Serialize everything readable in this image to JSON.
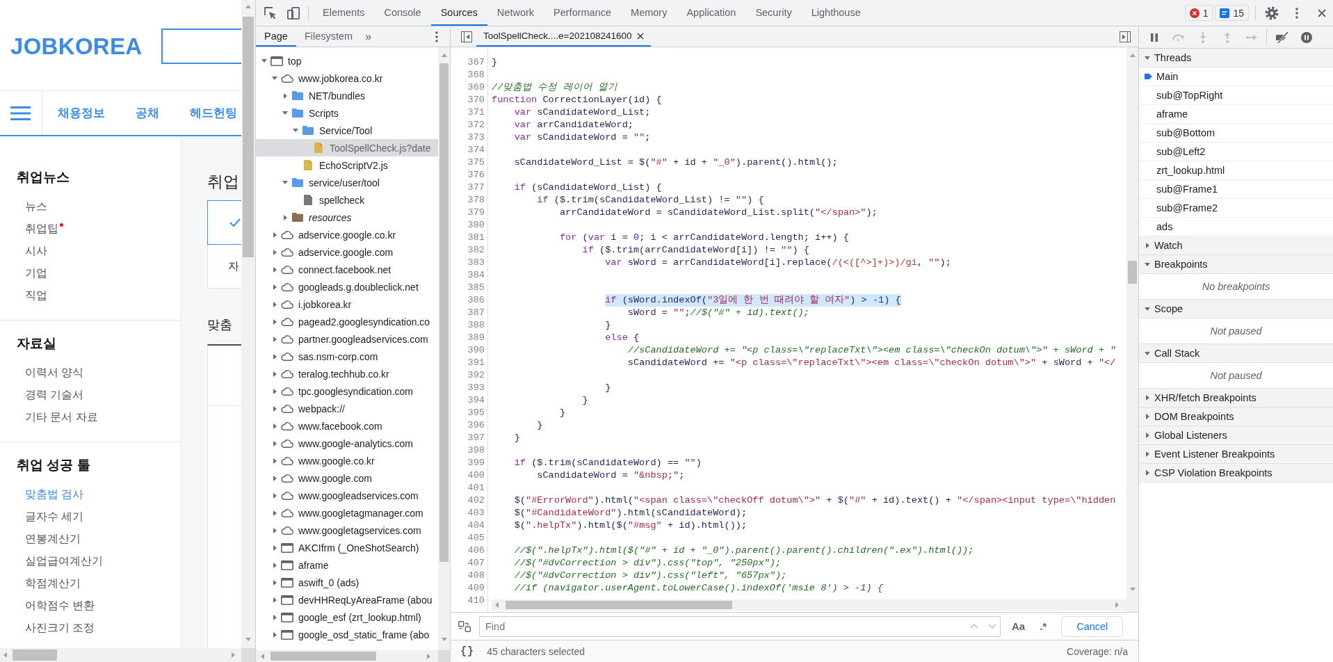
{
  "website": {
    "logo": "JOBKOREA",
    "nav_items": [
      "채용정보",
      "공채",
      "헤드헌팅"
    ],
    "sidebar": [
      {
        "title": "취업뉴스",
        "items": [
          {
            "label": "뉴스",
            "selected": false,
            "new": false
          },
          {
            "label": "취업팁",
            "selected": false,
            "new": true
          },
          {
            "label": "시사",
            "selected": false,
            "new": false
          },
          {
            "label": "기업",
            "selected": false,
            "new": false
          },
          {
            "label": "직업",
            "selected": false,
            "new": false
          }
        ]
      },
      {
        "title": "자료실",
        "items": [
          {
            "label": "이력서 양식",
            "selected": false,
            "new": false
          },
          {
            "label": "경력 기술서",
            "selected": false,
            "new": false
          },
          {
            "label": "기타 문서 자료",
            "selected": false,
            "new": false
          }
        ]
      },
      {
        "title": "취업 성공 툴",
        "items": [
          {
            "label": "맞춤법 검사",
            "selected": true,
            "new": false
          },
          {
            "label": "글자수 세기",
            "selected": false,
            "new": false
          },
          {
            "label": "연봉계산기",
            "selected": false,
            "new": false
          },
          {
            "label": "실업급여계산기",
            "selected": false,
            "new": false
          },
          {
            "label": "학점계산기",
            "selected": false,
            "new": false
          },
          {
            "label": "어학점수 변환",
            "selected": false,
            "new": false
          },
          {
            "label": "사진크기 조정",
            "selected": false,
            "new": false
          }
        ]
      }
    ],
    "content": {
      "heading": "취업",
      "step_label": "자",
      "section_heading": "맞춤"
    }
  },
  "devtools": {
    "tabs": [
      {
        "label": "Elements",
        "selected": false
      },
      {
        "label": "Console",
        "selected": false
      },
      {
        "label": "Sources",
        "selected": true
      },
      {
        "label": "Network",
        "selected": false
      },
      {
        "label": "Performance",
        "selected": false
      },
      {
        "label": "Memory",
        "selected": false
      },
      {
        "label": "Application",
        "selected": false
      },
      {
        "label": "Security",
        "selected": false
      },
      {
        "label": "Lighthouse",
        "selected": false
      }
    ],
    "error_count": "1",
    "message_count": "15",
    "navigator": {
      "tabs": [
        {
          "label": "Page",
          "selected": true
        },
        {
          "label": "Filesystem",
          "selected": false
        }
      ],
      "more_tabs": "»",
      "tree": [
        {
          "label": "top",
          "kind": "frame",
          "expanded": true,
          "selected": false,
          "children": [
            {
              "label": "www.jobkorea.co.kr",
              "kind": "domain",
              "expanded": true,
              "selected": false,
              "children": [
                {
                  "label": "NET/bundles",
                  "kind": "folder",
                  "expanded": false,
                  "selected": false
                },
                {
                  "label": "Scripts",
                  "kind": "folder",
                  "expanded": true,
                  "selected": false,
                  "children": [
                    {
                      "label": "Service/Tool",
                      "kind": "folder",
                      "expanded": true,
                      "selected": false,
                      "children": [
                        {
                          "label": "ToolSpellCheck.js?date",
                          "kind": "script",
                          "selected": true
                        }
                      ]
                    },
                    {
                      "label": "EchoScriptV2.js",
                      "kind": "script",
                      "selected": false
                    }
                  ]
                },
                {
                  "label": "service/user/tool",
                  "kind": "folder",
                  "expanded": true,
                  "selected": false,
                  "children": [
                    {
                      "label": "spellcheck",
                      "kind": "document",
                      "selected": false
                    }
                  ]
                },
                {
                  "label": "resources",
                  "kind": "resources",
                  "expanded": false,
                  "selected": false
                }
              ]
            },
            {
              "label": "adservice.google.co.kr",
              "kind": "domain",
              "expanded": false,
              "selected": false
            },
            {
              "label": "adservice.google.com",
              "kind": "domain",
              "expanded": false,
              "selected": false
            },
            {
              "label": "connect.facebook.net",
              "kind": "domain",
              "expanded": false,
              "selected": false
            },
            {
              "label": "googleads.g.doubleclick.net",
              "kind": "domain",
              "expanded": false,
              "selected": false
            },
            {
              "label": "i.jobkorea.kr",
              "kind": "domain",
              "expanded": false,
              "selected": false
            },
            {
              "label": "pagead2.googlesyndication.co",
              "kind": "domain",
              "expanded": false,
              "selected": false
            },
            {
              "label": "partner.googleadservices.com",
              "kind": "domain",
              "expanded": false,
              "selected": false
            },
            {
              "label": "sas.nsm-corp.com",
              "kind": "domain",
              "expanded": false,
              "selected": false
            },
            {
              "label": "teralog.techhub.co.kr",
              "kind": "domain",
              "expanded": false,
              "selected": false
            },
            {
              "label": "tpc.googlesyndication.com",
              "kind": "domain",
              "expanded": false,
              "selected": false
            },
            {
              "label": "webpack://",
              "kind": "domain",
              "expanded": false,
              "selected": false
            },
            {
              "label": "www.facebook.com",
              "kind": "domain",
              "expanded": false,
              "selected": false
            },
            {
              "label": "www.google-analytics.com",
              "kind": "domain",
              "expanded": false,
              "selected": false
            },
            {
              "label": "www.google.co.kr",
              "kind": "domain",
              "expanded": false,
              "selected": false
            },
            {
              "label": "www.google.com",
              "kind": "domain",
              "expanded": false,
              "selected": false
            },
            {
              "label": "www.googleadservices.com",
              "kind": "domain",
              "expanded": false,
              "selected": false
            },
            {
              "label": "www.googletagmanager.com",
              "kind": "domain",
              "expanded": false,
              "selected": false
            },
            {
              "label": "www.googletagservices.com",
              "kind": "domain",
              "expanded": false,
              "selected": false
            },
            {
              "label": "AKCIfrm (_OneShotSearch)",
              "kind": "frame",
              "expanded": false,
              "selected": false
            },
            {
              "label": "aframe",
              "kind": "frame",
              "expanded": false,
              "selected": false
            },
            {
              "label": "aswift_0 (ads)",
              "kind": "frame",
              "expanded": false,
              "selected": false
            },
            {
              "label": "devHHReqLyAreaFrame (abou",
              "kind": "frame",
              "expanded": false,
              "selected": false
            },
            {
              "label": "google_esf (zrt_lookup.html)",
              "kind": "frame",
              "expanded": false,
              "selected": false
            },
            {
              "label": "google_osd_static_frame (abo",
              "kind": "frame",
              "expanded": false,
              "selected": false
            }
          ]
        }
      ]
    },
    "editor": {
      "file_tab": "ToolSpellCheck....e=202108241600",
      "lines": [
        {
          "number": "367",
          "selected": false,
          "tokens": [
            {
              "kind": "plain",
              "text": "}"
            }
          ]
        },
        {
          "number": "368",
          "selected": false
        },
        {
          "number": "369",
          "selected": false,
          "tokens": [
            {
              "kind": "comment",
              "text": "//맞춤법 수정 레이어 열기"
            }
          ]
        },
        {
          "number": "370",
          "selected": false,
          "tokens": [
            {
              "kind": "keyword",
              "text": "function"
            },
            {
              "kind": "plain",
              "text": " CorrectionLayer(id) {"
            }
          ]
        },
        {
          "number": "371",
          "selected": false,
          "tokens": [
            {
              "kind": "keyword",
              "text": "    var"
            },
            {
              "kind": "plain",
              "text": " sCandidateWord_List;"
            }
          ]
        },
        {
          "number": "372",
          "selected": false,
          "tokens": [
            {
              "kind": "keyword",
              "text": "    var"
            },
            {
              "kind": "plain",
              "text": " arrCandidateWord;"
            }
          ]
        },
        {
          "number": "373",
          "selected": false,
          "tokens": [
            {
              "kind": "keyword",
              "text": "    var"
            },
            {
              "kind": "plain",
              "text": " sCandidateWord = "
            },
            {
              "kind": "string",
              "text": "\"\""
            },
            {
              "kind": "plain",
              "text": ";"
            }
          ]
        },
        {
          "number": "374",
          "selected": false
        },
        {
          "number": "375",
          "selected": false,
          "tokens": [
            {
              "kind": "plain",
              "text": "    sCandidateWord_List = $("
            },
            {
              "kind": "string",
              "text": "\"#\""
            },
            {
              "kind": "plain",
              "text": " + id + "
            },
            {
              "kind": "string",
              "text": "\"_0\""
            },
            {
              "kind": "plain",
              "text": ").parent().html();"
            }
          ]
        },
        {
          "number": "376",
          "selected": false
        },
        {
          "number": "377",
          "selected": false,
          "tokens": [
            {
              "kind": "keyword",
              "text": "    if"
            },
            {
              "kind": "plain",
              "text": " (sCandidateWord_List) {"
            }
          ]
        },
        {
          "number": "378",
          "selected": false,
          "tokens": [
            {
              "kind": "keyword",
              "text": "        if"
            },
            {
              "kind": "plain",
              "text": " ($.trim(sCandidateWord_List) != "
            },
            {
              "kind": "string",
              "text": "\"\""
            },
            {
              "kind": "plain",
              "text": ") {"
            }
          ]
        },
        {
          "number": "379",
          "selected": false,
          "tokens": [
            {
              "kind": "plain",
              "text": "            arrCandidateWord = sCandidateWord_List.split("
            },
            {
              "kind": "string",
              "text": "\"</span>\""
            },
            {
              "kind": "plain",
              "text": ");"
            }
          ]
        },
        {
          "number": "380",
          "selected": false
        },
        {
          "number": "381",
          "selected": false,
          "tokens": [
            {
              "kind": "keyword",
              "text": "            for"
            },
            {
              "kind": "plain",
              "text": " ("
            },
            {
              "kind": "keyword",
              "text": "var"
            },
            {
              "kind": "plain",
              "text": " i = "
            },
            {
              "kind": "number",
              "text": "0"
            },
            {
              "kind": "plain",
              "text": "; i < arrCandidateWord.length; i++) {"
            }
          ]
        },
        {
          "number": "382",
          "selected": false,
          "tokens": [
            {
              "kind": "keyword",
              "text": "                if"
            },
            {
              "kind": "plain",
              "text": " ($.trim(arrCandidateWord[i]) != "
            },
            {
              "kind": "string",
              "text": "\"\""
            },
            {
              "kind": "plain",
              "text": ") {"
            }
          ]
        },
        {
          "number": "383",
          "selected": false,
          "tokens": [
            {
              "kind": "keyword",
              "text": "                    var"
            },
            {
              "kind": "plain",
              "text": " sWord = arrCandidateWord[i].replace("
            },
            {
              "kind": "regex",
              "text": "/(<([^>]+)>)/gi"
            },
            {
              "kind": "plain",
              "text": ", "
            },
            {
              "kind": "string",
              "text": "\"\""
            },
            {
              "kind": "plain",
              "text": ");"
            }
          ]
        },
        {
          "number": "384",
          "selected": false
        },
        {
          "number": "385",
          "selected": false
        },
        {
          "number": "386",
          "selected": true,
          "tokens": [
            {
              "kind": "keyword",
              "text": "                    if"
            },
            {
              "kind": "plain",
              "text": " (sWord.indexOf("
            },
            {
              "kind": "string",
              "text": "\"3일에 한 번 때려야 할 여자\""
            },
            {
              "kind": "plain",
              "text": ") > "
            },
            {
              "kind": "number",
              "text": "-1"
            },
            {
              "kind": "plain",
              "text": ") {"
            }
          ]
        },
        {
          "number": "387",
          "selected": false,
          "tokens": [
            {
              "kind": "plain",
              "text": "                        sWord = "
            },
            {
              "kind": "string",
              "text": "\"\""
            },
            {
              "kind": "plain",
              "text": ";"
            },
            {
              "kind": "comment",
              "text": "//$(\"#\" + id).text();"
            }
          ]
        },
        {
          "number": "388",
          "selected": false,
          "tokens": [
            {
              "kind": "plain",
              "text": "                    }"
            }
          ]
        },
        {
          "number": "389",
          "selected": false,
          "tokens": [
            {
              "kind": "keyword",
              "text": "                    else"
            },
            {
              "kind": "plain",
              "text": " {"
            }
          ]
        },
        {
          "number": "390",
          "selected": false,
          "tokens": [
            {
              "kind": "comment",
              "text": "                        //sCandidateWord += \"<p class=\\\"replaceTxt\\\"><em class=\\\"checkOn dotum\\\">\" + sWord + \""
            }
          ]
        },
        {
          "number": "391",
          "selected": false,
          "tokens": [
            {
              "kind": "plain",
              "text": "                        sCandidateWord += "
            },
            {
              "kind": "string",
              "text": "\"<p class=\\\"replaceTxt\\\"><em class=\\\"checkOn dotum\\\">\""
            },
            {
              "kind": "plain",
              "text": " + sWord + "
            },
            {
              "kind": "string",
              "text": "\"</"
            }
          ]
        },
        {
          "number": "392",
          "selected": false
        },
        {
          "number": "393",
          "selected": false,
          "tokens": [
            {
              "kind": "plain",
              "text": "                    }"
            }
          ]
        },
        {
          "number": "394",
          "selected": false,
          "tokens": [
            {
              "kind": "plain",
              "text": "                }"
            }
          ]
        },
        {
          "number": "395",
          "selected": false,
          "tokens": [
            {
              "kind": "plain",
              "text": "            }"
            }
          ]
        },
        {
          "number": "396",
          "selected": false,
          "tokens": [
            {
              "kind": "plain",
              "text": "        }"
            }
          ]
        },
        {
          "number": "397",
          "selected": false,
          "tokens": [
            {
              "kind": "plain",
              "text": "    }"
            }
          ]
        },
        {
          "number": "398",
          "selected": false
        },
        {
          "number": "399",
          "selected": false,
          "tokens": [
            {
              "kind": "keyword",
              "text": "    if"
            },
            {
              "kind": "plain",
              "text": " ($.trim(sCandidateWord) == "
            },
            {
              "kind": "string",
              "text": "\"\""
            },
            {
              "kind": "plain",
              "text": ")"
            }
          ]
        },
        {
          "number": "400",
          "selected": false,
          "tokens": [
            {
              "kind": "plain",
              "text": "        sCandidateWord = "
            },
            {
              "kind": "string",
              "text": "\"&nbsp;\""
            },
            {
              "kind": "plain",
              "text": ";"
            }
          ]
        },
        {
          "number": "401",
          "selected": false
        },
        {
          "number": "402",
          "selected": false,
          "tokens": [
            {
              "kind": "plain",
              "text": "    $("
            },
            {
              "kind": "string",
              "text": "\"#ErrorWord\""
            },
            {
              "kind": "plain",
              "text": ").html("
            },
            {
              "kind": "string",
              "text": "\"<span class=\\\"checkOff dotum\\\">\""
            },
            {
              "kind": "plain",
              "text": " + $("
            },
            {
              "kind": "string",
              "text": "\"#\""
            },
            {
              "kind": "plain",
              "text": " + id).text() + "
            },
            {
              "kind": "string",
              "text": "\"</span><input type=\\\"hidden"
            }
          ]
        },
        {
          "number": "403",
          "selected": false,
          "tokens": [
            {
              "kind": "plain",
              "text": "    $("
            },
            {
              "kind": "string",
              "text": "\"#CandidateWord\""
            },
            {
              "kind": "plain",
              "text": ").html(sCandidateWord);"
            }
          ]
        },
        {
          "number": "404",
          "selected": false,
          "tokens": [
            {
              "kind": "plain",
              "text": "    $("
            },
            {
              "kind": "string",
              "text": "\".helpTx\""
            },
            {
              "kind": "plain",
              "text": ").html($("
            },
            {
              "kind": "string",
              "text": "\"#msg\""
            },
            {
              "kind": "plain",
              "text": " + id).html());"
            }
          ]
        },
        {
          "number": "405",
          "selected": false
        },
        {
          "number": "406",
          "selected": false,
          "tokens": [
            {
              "kind": "comment",
              "text": "    //$(\".helpTx\").html($(\"#\" + id + \"_0\").parent().parent().children(\".ex\").html());"
            }
          ]
        },
        {
          "number": "407",
          "selected": false,
          "tokens": [
            {
              "kind": "comment",
              "text": "    //$(\"#dvCorrection > div\").css(\"top\", \"250px\");"
            }
          ]
        },
        {
          "number": "408",
          "selected": false,
          "tokens": [
            {
              "kind": "comment",
              "text": "    //$(\"#dvCorrection > div\").css(\"left\", \"657px\");"
            }
          ]
        },
        {
          "number": "409",
          "selected": false,
          "tokens": [
            {
              "kind": "comment",
              "text": "    //if (navigator.userAgent.toLowerCase().indexOf('msie 8') > -1) {"
            }
          ]
        },
        {
          "number": "410",
          "selected": false
        }
      ],
      "find": {
        "placeholder": "Find",
        "buttons": [
          {
            "kind": "previous",
            "disabled": true
          },
          {
            "kind": "next",
            "disabled": true
          }
        ],
        "match_case": "Aa",
        "regex": ".*",
        "cancel": "Cancel"
      },
      "status": {
        "pretty_print": "{}",
        "selection": "45 characters selected",
        "coverage": "Coverage: n/a"
      }
    },
    "debugger": {
      "toolbar": [
        {
          "kind": "pause",
          "disabled": false
        },
        {
          "kind": "stepover",
          "disabled": true
        },
        {
          "kind": "stepinto",
          "disabled": true
        },
        {
          "kind": "stepout",
          "disabled": true
        },
        {
          "kind": "step",
          "disabled": true
        },
        {
          "kind": "deactivate",
          "disabled": false
        },
        {
          "kind": "exceptions",
          "disabled": false
        }
      ],
      "sections": [
        {
          "title": "Threads",
          "expanded": true,
          "threads": [
            {
              "name": "Main",
              "selected": true
            },
            {
              "name": "sub@TopRight",
              "selected": false
            },
            {
              "name": "aframe",
              "selected": false
            },
            {
              "name": "sub@Bottom",
              "selected": false
            },
            {
              "name": "sub@Left2",
              "selected": false
            },
            {
              "name": "zrt_lookup.html",
              "selected": false
            },
            {
              "name": "sub@Frame1",
              "selected": false
            },
            {
              "name": "sub@Frame2",
              "selected": false
            },
            {
              "name": "ads",
              "selected": false
            }
          ]
        },
        {
          "title": "Watch",
          "expanded": false
        },
        {
          "title": "Breakpoints",
          "expanded": true,
          "message": "No breakpoints"
        },
        {
          "title": "Scope",
          "expanded": true,
          "message": "Not paused"
        },
        {
          "title": "Call Stack",
          "expanded": true,
          "message": "Not paused"
        },
        {
          "title": "XHR/fetch Breakpoints",
          "expanded": false
        },
        {
          "title": "DOM Breakpoints",
          "expanded": false
        },
        {
          "title": "Global Listeners",
          "expanded": false
        },
        {
          "title": "Event Listener Breakpoints",
          "expanded": false
        },
        {
          "title": "CSP Violation Breakpoints",
          "expanded": false
        }
      ]
    }
  }
}
